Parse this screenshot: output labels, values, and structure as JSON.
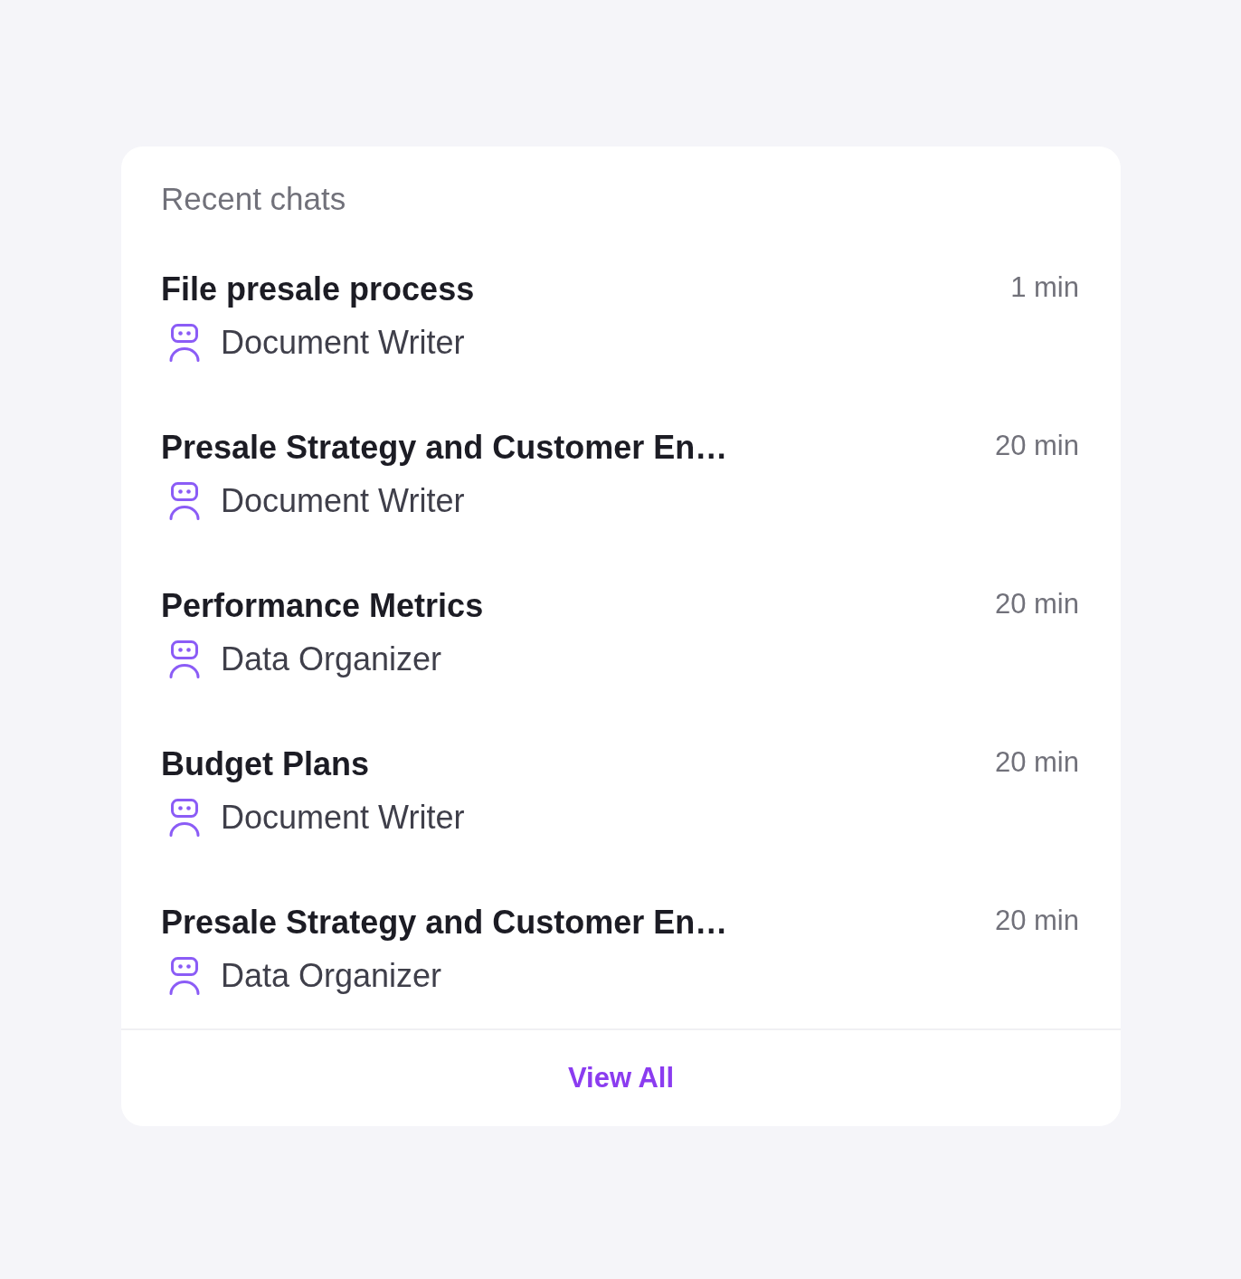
{
  "header": {
    "title": "Recent chats"
  },
  "chats": [
    {
      "title": "File presale process",
      "assistant": "Document Writer",
      "time": "1 min"
    },
    {
      "title": "Presale Strategy and Customer En…",
      "assistant": "Document Writer",
      "time": "20 min"
    },
    {
      "title": "Performance Metrics",
      "assistant": "Data Organizer",
      "time": "20 min"
    },
    {
      "title": "Budget Plans",
      "assistant": "Document Writer",
      "time": "20 min"
    },
    {
      "title": "Presale Strategy and Customer En…",
      "assistant": "Data Organizer",
      "time": "20 min"
    }
  ],
  "footer": {
    "link": "View All"
  }
}
